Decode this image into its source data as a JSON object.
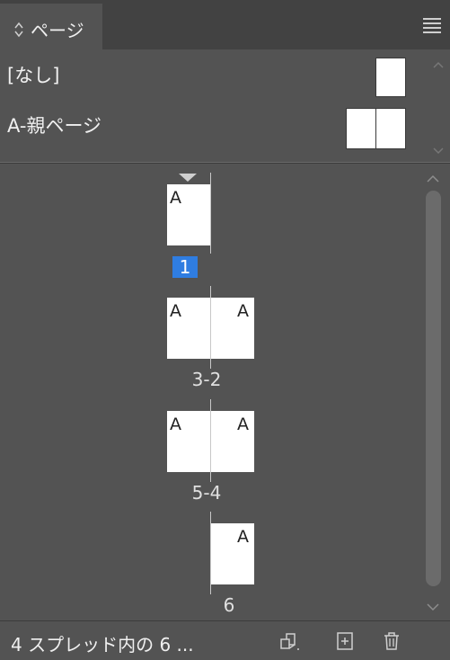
{
  "tab": {
    "label": "ページ"
  },
  "masters": [
    {
      "label": "[なし]"
    },
    {
      "label": "A-親ページ"
    }
  ],
  "pages": {
    "spread1": {
      "number": "1",
      "left_letter": "A"
    },
    "spread2": {
      "number": "3-2",
      "left_letter": "A",
      "right_letter": "A"
    },
    "spread3": {
      "number": "5-4",
      "left_letter": "A",
      "right_letter": "A"
    },
    "spread4": {
      "number": "6",
      "right_letter": "A"
    }
  },
  "footer": {
    "status": "4 スプレッド内の 6 ...",
    "icons": [
      "edit-page-size-icon",
      "new-page-icon",
      "delete-page-icon"
    ]
  },
  "colors": {
    "panel_bg": "#535353",
    "tabbar_bg": "#424242",
    "selection": "#2f7de1"
  }
}
